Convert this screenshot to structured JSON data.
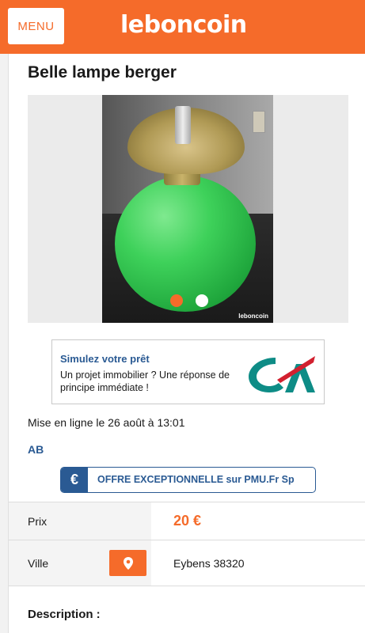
{
  "header": {
    "menu_label": "MENU",
    "logo_text": "leboncoin",
    "brand_color": "#f56b2a"
  },
  "listing": {
    "title": "Belle lampe berger",
    "gallery": {
      "image_count": 2,
      "active_index": 0,
      "watermark": "leboncoin"
    },
    "posted": "Mise en ligne le 26 août à 13:01",
    "seller": "AB"
  },
  "ad": {
    "title": "Simulez votre prêt",
    "text": "Un projet immobilier ? Une réponse de principe immédiate !",
    "logo_icon": "credit-agricole-logo"
  },
  "promo": {
    "icon": "€",
    "text": "OFFRE EXCEPTIONNELLE sur PMU.Fr Sp"
  },
  "details": {
    "price_label": "Prix",
    "price_value": "20 €",
    "city_label": "Ville",
    "city_value": "Eybens 38320",
    "map_icon": "map-pin-icon"
  },
  "description": {
    "label": "Description :"
  }
}
